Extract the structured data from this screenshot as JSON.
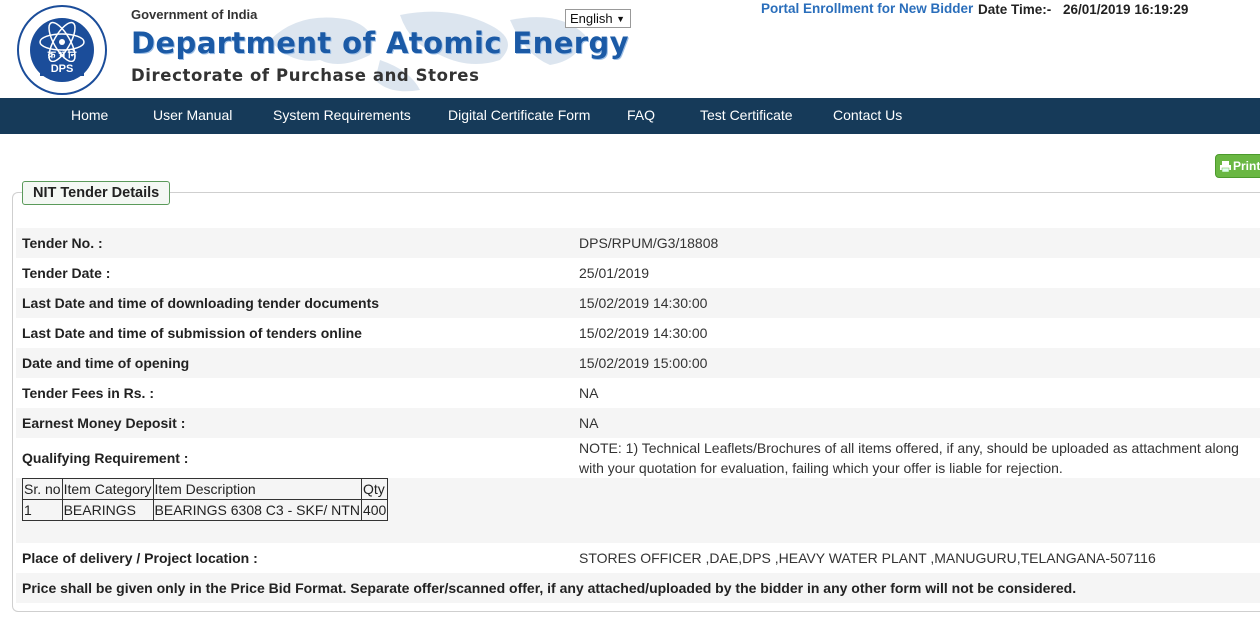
{
  "header": {
    "gov_line": "Government of India",
    "dept_name": "Department of Atomic Energy",
    "directorate": "Directorate of Purchase and Stores",
    "logo_text": "DPS",
    "logo_hindi": "क्र भं नि",
    "language": "English",
    "enroll_link": "Portal Enrollment for New Bidder",
    "datetime_label": "Date Time:-",
    "datetime_value": "26/01/2019 16:19:29"
  },
  "nav": [
    "Home",
    "User Manual",
    "System Requirements",
    "Digital Certificate Form",
    "FAQ",
    "Test Certificate",
    "Contact Us"
  ],
  "print_label": "Print",
  "panel": {
    "title": "NIT Tender Details",
    "fields": [
      {
        "label": "Tender No. :",
        "value": "DPS/RPUM/G3/18808"
      },
      {
        "label": "Tender Date :",
        "value": "25/01/2019"
      },
      {
        "label": "Last Date and time of downloading tender documents",
        "value": "15/02/2019 14:30:00"
      },
      {
        "label": "Last Date and time of submission of tenders online",
        "value": "15/02/2019 14:30:00"
      },
      {
        "label": "Date and time of opening",
        "value": "15/02/2019 15:00:00"
      },
      {
        "label": "Tender Fees in Rs. :",
        "value": "NA"
      },
      {
        "label": "Earnest Money Deposit :",
        "value": "NA"
      }
    ],
    "qualifying_label": "Qualifying Requirement :",
    "qualifying_value": "NOTE: 1) Technical Leaflets/Brochures of all items offered, if any, should be uploaded as attachment along with your quotation for evaluation, failing which your offer is liable for rejection.",
    "items_table": {
      "headers": [
        "Sr. no",
        "Item Category",
        "Item Description",
        "Qty"
      ],
      "rows": [
        [
          "1",
          "BEARINGS",
          "BEARINGS 6308 C3 - SKF/ NTN",
          "400"
        ]
      ]
    },
    "delivery_label": "Place of delivery / Project location :",
    "delivery_value": "STORES OFFICER ,DAE,DPS ,HEAVY WATER PLANT ,MANUGURU,TELANGANA-507116",
    "price_note": "Price shall be given only in the Price Bid Format. Separate offer/scanned offer, if any attached/uploaded by the bidder in any other form will not be considered."
  }
}
